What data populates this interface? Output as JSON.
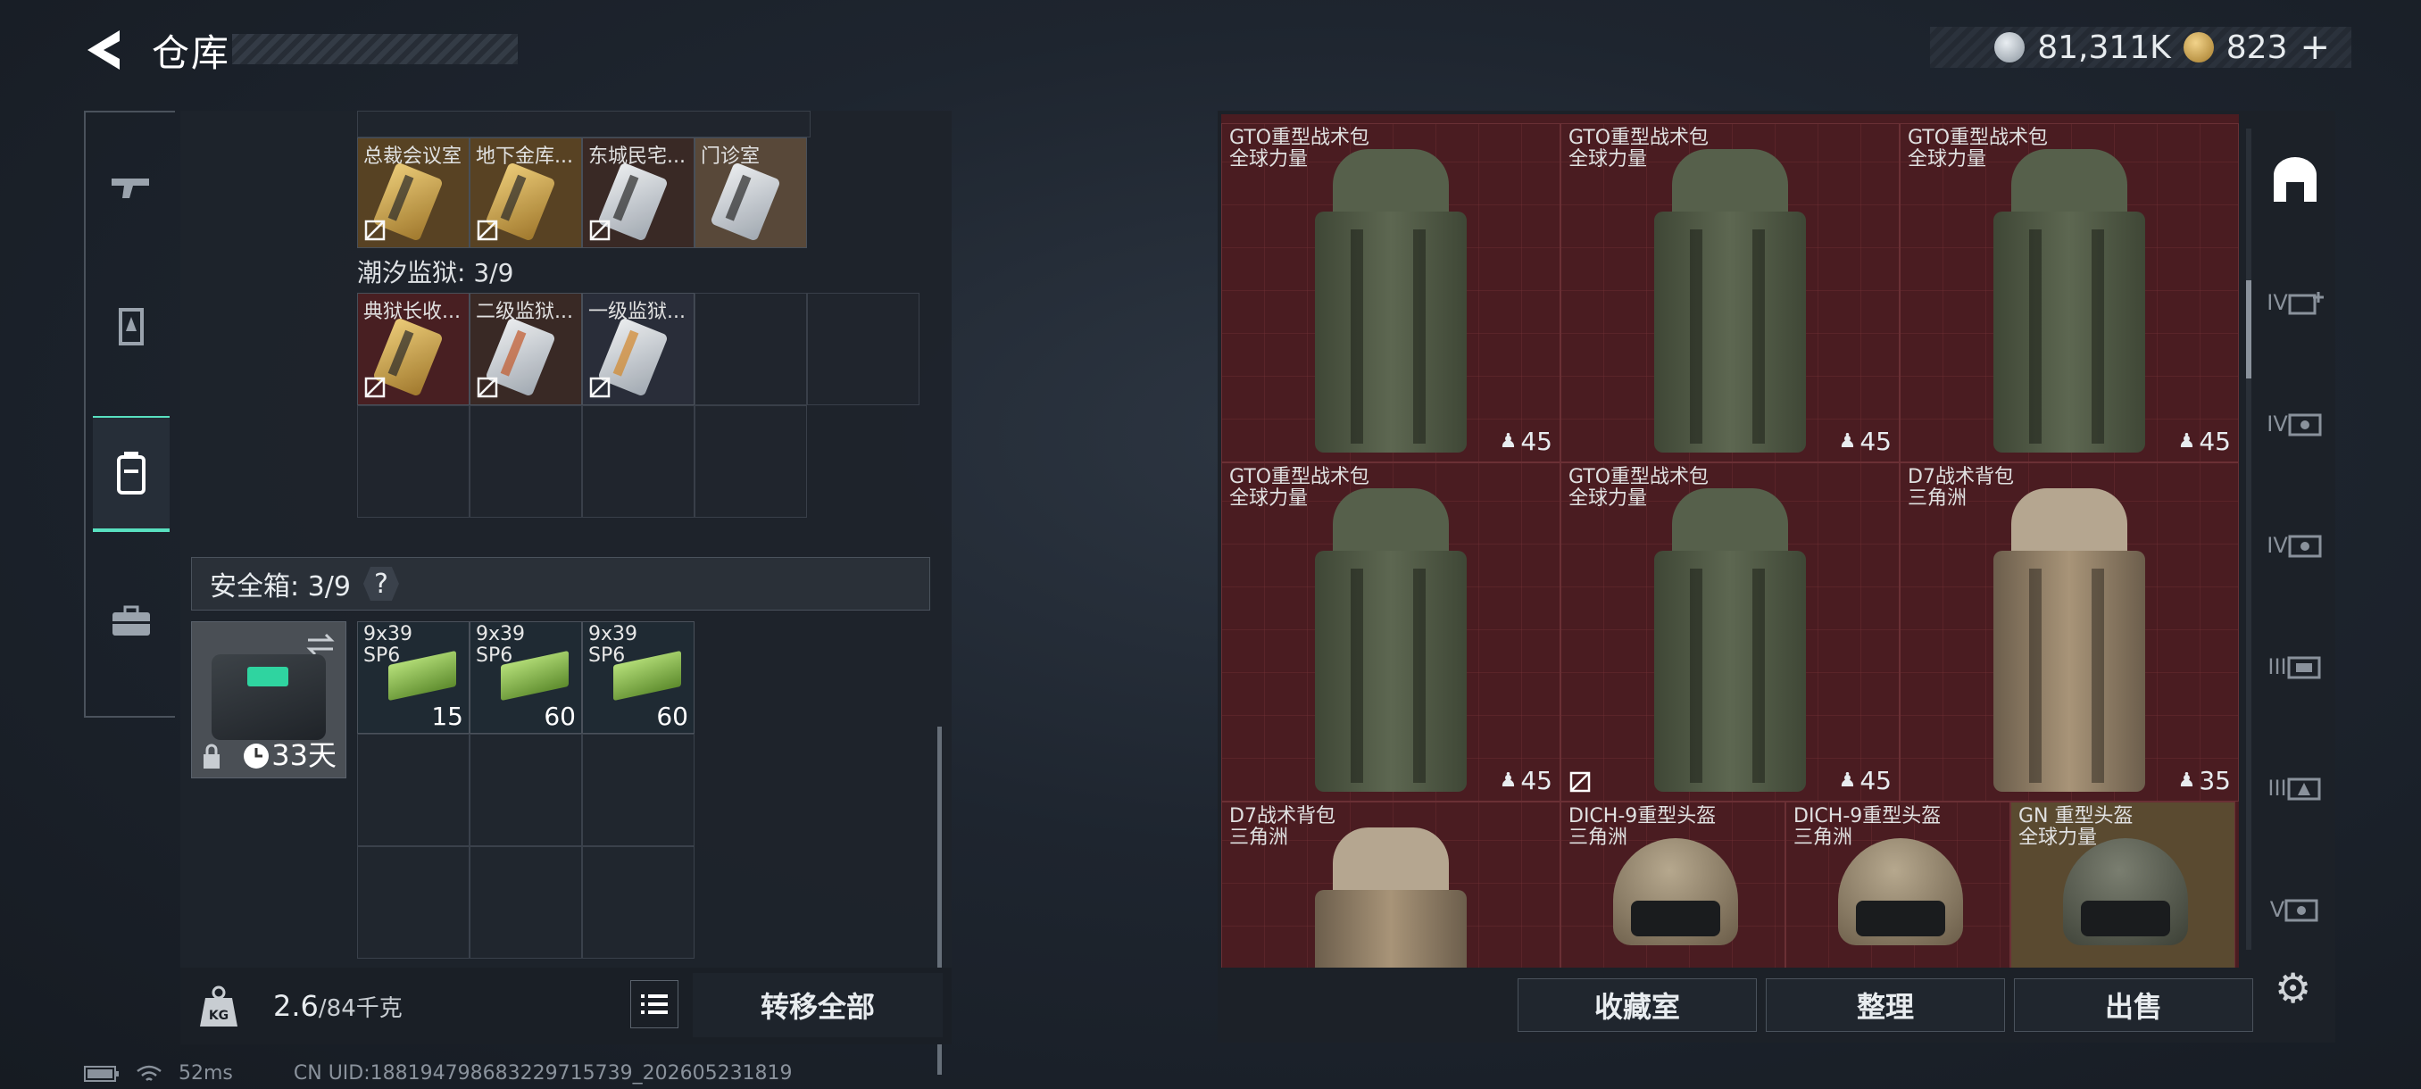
{
  "header": {
    "title": "仓库",
    "currency_silver": "81,311K",
    "currency_gold": "823"
  },
  "leftnav": {
    "items": [
      "weapon-tab",
      "armor-tab",
      "backpack-tab",
      "case-tab"
    ]
  },
  "inventory": {
    "top_keys": [
      {
        "label": "总裁会议室",
        "color": "gold"
      },
      {
        "label": "地下金库...",
        "color": "gold"
      },
      {
        "label": "东城民宅...",
        "color": "white"
      },
      {
        "label": "门诊室",
        "color": "white"
      }
    ],
    "prison_label": "潮汐监狱: 3/9",
    "prison_keys": [
      {
        "label": "典狱长收...",
        "color": "gold"
      },
      {
        "label": "二级监狱...",
        "color": "white"
      },
      {
        "label": "一级监狱...",
        "color": "white"
      }
    ],
    "safe_label": "安全箱: 3/9",
    "safe_help": "?",
    "safe_days": "33天",
    "ammo": [
      {
        "l1": "9x39",
        "l2": "SP6",
        "count": "15"
      },
      {
        "l1": "9x39",
        "l2": "SP6",
        "count": "60"
      },
      {
        "l1": "9x39",
        "l2": "SP6",
        "count": "60"
      }
    ]
  },
  "bottombar": {
    "weight_current": "2.6",
    "weight_max": "/84千克",
    "transfer_label": "转移全部"
  },
  "status": {
    "ping": "52ms",
    "uid": "CN UID:18819479868322971573​9_202605231819"
  },
  "stash": {
    "items": [
      {
        "name": "GTO重型战术包",
        "maker": "全球力量",
        "count": "45",
        "type": "green"
      },
      {
        "name": "GTO重型战术包",
        "maker": "全球力量",
        "count": "45",
        "type": "green"
      },
      {
        "name": "GTO重型战术包",
        "maker": "全球力量",
        "count": "45",
        "type": "green"
      },
      {
        "name": "GTO重型战术包",
        "maker": "全球力量",
        "count": "45",
        "type": "green"
      },
      {
        "name": "GTO重型战术包",
        "maker": "全球力量",
        "count": "45",
        "type": "green"
      },
      {
        "name": "D7战术背包",
        "maker": "三角洲",
        "count": "35",
        "type": "tan"
      },
      {
        "name": "D7战术背包",
        "maker": "三角洲",
        "count": "",
        "type": "tan"
      },
      {
        "name": "DICH-9重型头盔",
        "maker": "三角洲",
        "count": "",
        "type": "helmet"
      },
      {
        "name": "DICH-9重型头盔",
        "maker": "三角洲",
        "count": "",
        "type": "helmet"
      },
      {
        "name": "GN 重型头盔",
        "maker": "全球力量",
        "count": "",
        "type": "helmet-dark"
      }
    ],
    "buttons": [
      "收藏室",
      "整理",
      "出售"
    ]
  }
}
